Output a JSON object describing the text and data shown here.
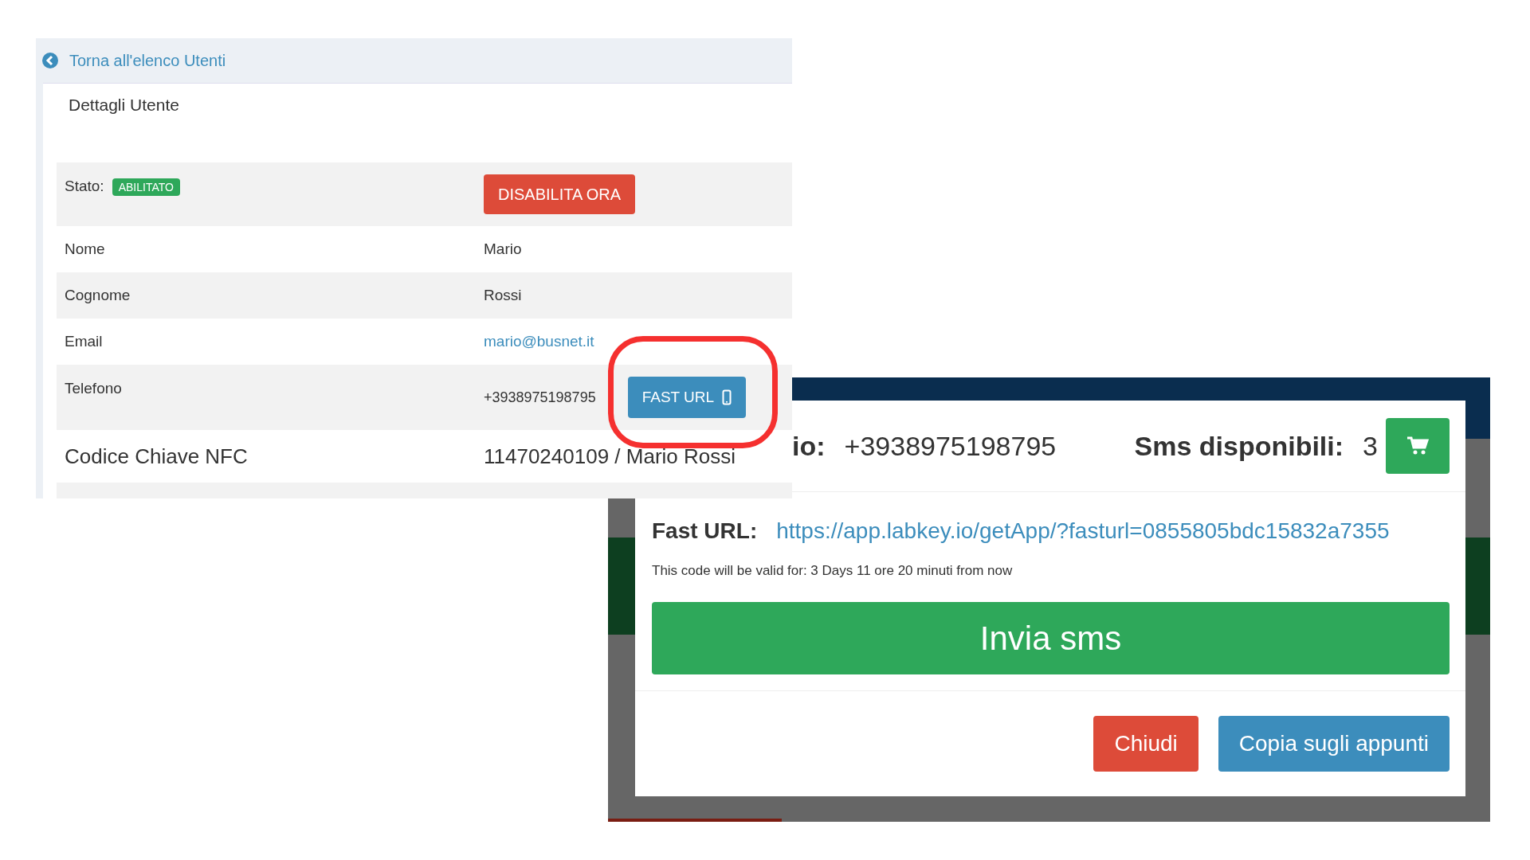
{
  "back_link": {
    "label": "Torna all'elenco Utenti"
  },
  "card": {
    "title": "Dettagli Utente",
    "rows": [
      {
        "kind": "status",
        "label": "Stato:",
        "badge": "ABILITATO",
        "action": "DISABILITA ORA"
      },
      {
        "kind": "text",
        "label": "Nome",
        "value": "Mario"
      },
      {
        "kind": "text",
        "label": "Cognome",
        "value": "Rossi"
      },
      {
        "kind": "link",
        "label": "Email",
        "value": "mario@busnet.it"
      },
      {
        "kind": "phone",
        "label": "Telefono",
        "value": "+3938975198795",
        "action": "FAST URL"
      },
      {
        "kind": "large",
        "label": "Codice Chiave NFC",
        "value": "11470240109 / Mario Rossi"
      }
    ]
  },
  "modal": {
    "header_label": "io:",
    "phone": "+3938975198795",
    "sms_label": "Sms disponibili:",
    "sms_count": "3",
    "fast_url_label": "Fast URL:",
    "fast_url": "https://app.labkey.io/getApp/?fasturl=0855805bdc15832a7355",
    "validity": "This code will be valid for: 3 Days 11 ore 20 minuti from now",
    "send_button": "Invia sms",
    "buttons": [
      {
        "label": "Chiudi",
        "kind": "danger"
      },
      {
        "label": "Copia sugli appunti",
        "kind": "primary"
      }
    ]
  }
}
